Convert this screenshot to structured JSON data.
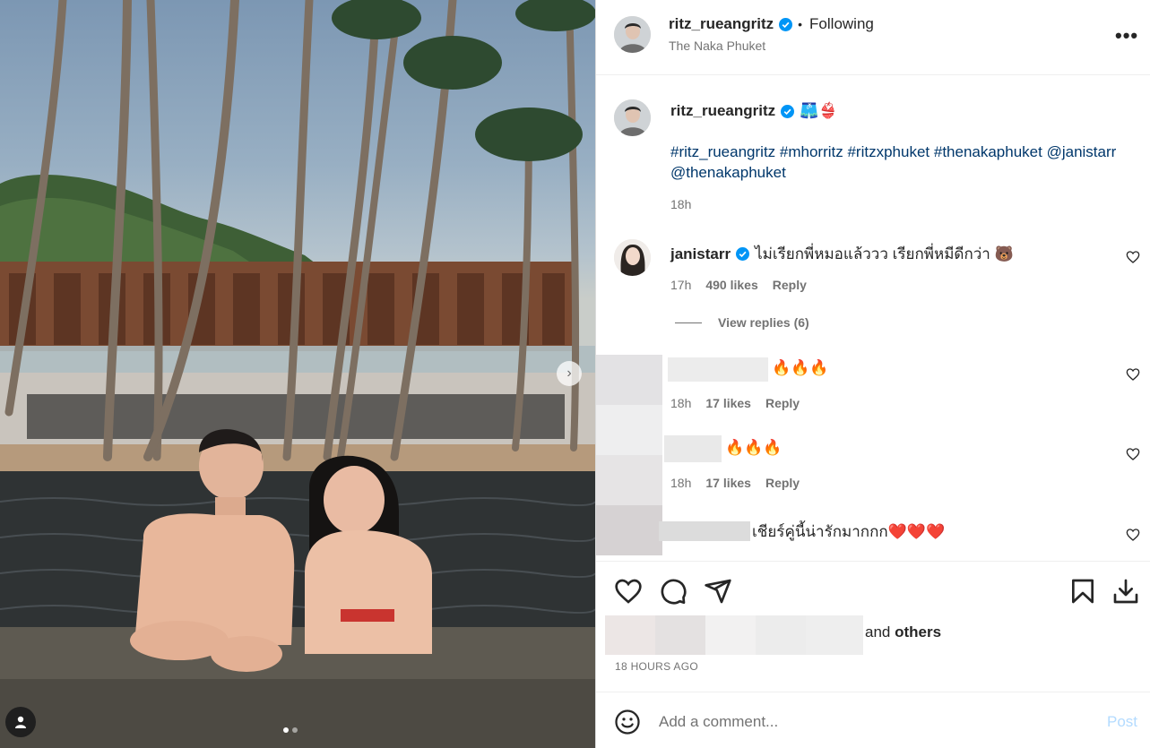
{
  "post": {
    "username": "ritz_rueangritz",
    "follow_status": "Following",
    "separator": "•",
    "location": "The Naka Phuket",
    "more_icon": "more-horizontal-icon",
    "verified_color": "#0095f6"
  },
  "caption": {
    "username": "ritz_rueangritz",
    "emojis": "🩳👙",
    "hashtags": [
      "#ritz_rueangritz",
      "#mhorritz",
      "#ritzxphuket",
      "#thenakaphuket",
      "@janistarr",
      "@thenakaphuket"
    ],
    "time": "18h"
  },
  "comments": [
    {
      "username": "janistarr",
      "text": "ไม่เรียกพี่หมอแล้ววว เรียกพี่หมีดีกว่า 🐻",
      "time": "17h",
      "likes": "490 likes",
      "reply": "Reply",
      "view_replies": "View replies (6)"
    },
    {
      "username": "",
      "text": "🔥🔥🔥",
      "time": "18h",
      "likes": "17 likes",
      "reply": "Reply"
    },
    {
      "username": "",
      "text": "🔥🔥🔥",
      "time": "18h",
      "likes": "17 likes",
      "reply": "Reply"
    },
    {
      "username": "",
      "text": "เชียร์คู่นี้น่ารักมากกก❤️❤️❤️"
    }
  ],
  "engagement": {
    "likes_prefix": "and",
    "likes_others": "others",
    "timestamp": "18 HOURS AGO"
  },
  "add_comment": {
    "placeholder": "Add a comment...",
    "post_label": "Post"
  },
  "carousel": {
    "slide_count": 2,
    "active_index": 0
  },
  "colors": {
    "link": "#00376b",
    "secondary_text": "#737373",
    "post_button_disabled": "#b3dbff"
  }
}
